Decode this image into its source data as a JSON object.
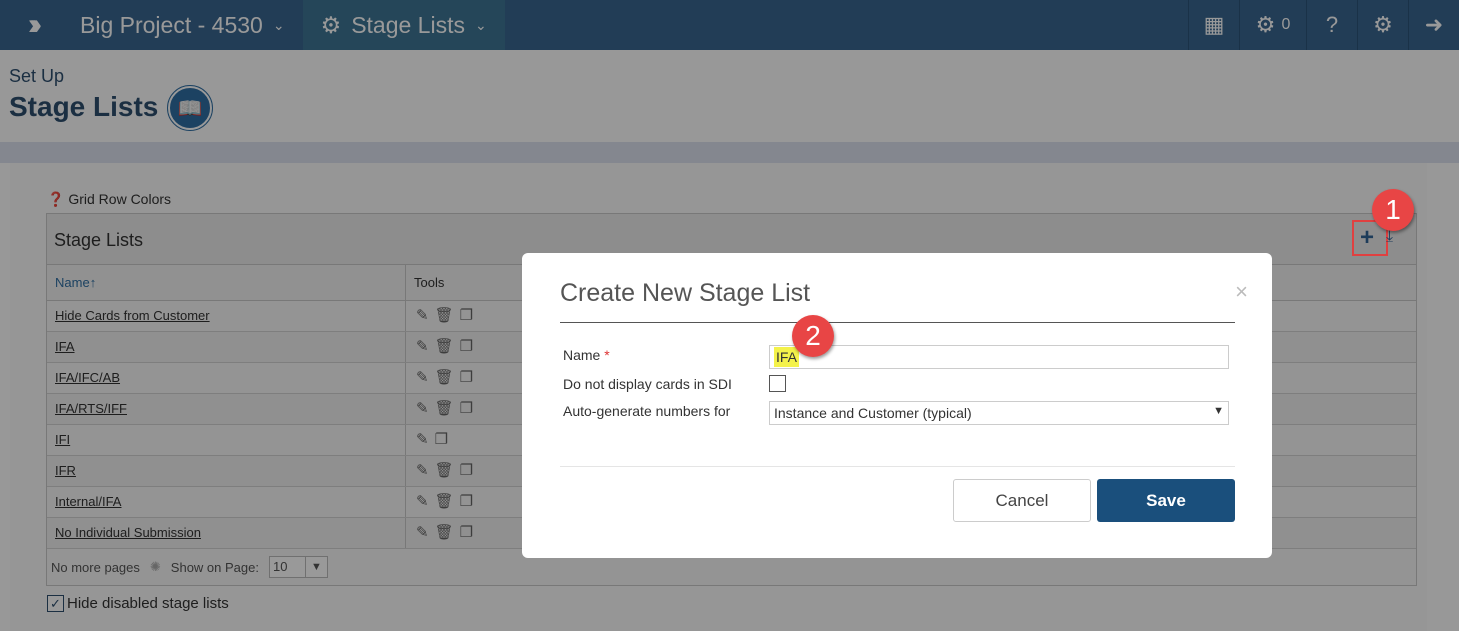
{
  "header": {
    "project": "Big Project - 4530",
    "section": "Stage Lists",
    "task_count": "0",
    "icons": [
      "menu-chevrons-icon",
      "schedule-icon",
      "gears-icon",
      "help-icon",
      "settings-icon",
      "logout-icon"
    ]
  },
  "page": {
    "supertitle": "Set Up",
    "title": "Stage Lists",
    "grid_row_colors": "Grid Row Colors"
  },
  "grid": {
    "title": "Stage Lists",
    "columns": [
      "Name",
      "Tools"
    ],
    "rows": [
      {
        "name": "Hide Cards from Customer",
        "delete": true
      },
      {
        "name": "IFA",
        "delete": true
      },
      {
        "name": "IFA/IFC/AB",
        "delete": true
      },
      {
        "name": "IFA/RTS/IFF",
        "delete": true
      },
      {
        "name": "IFI",
        "delete": false
      },
      {
        "name": "IFR",
        "delete": true
      },
      {
        "name": "Internal/IFA",
        "delete": true
      },
      {
        "name": "No Individual Submission",
        "delete": true
      }
    ],
    "pager": {
      "status": "No more pages",
      "show_label": "Show on Page:",
      "page_size": "10"
    },
    "hide_disabled": "Hide disabled stage lists"
  },
  "annotations": {
    "one": "1",
    "two": "2",
    "color": "#e84545"
  },
  "modal": {
    "title": "Create New Stage List",
    "close": "×",
    "name_label": "Name",
    "required": "*",
    "name_value": "IFA",
    "sdi_label": "Do not display cards in SDI",
    "sdi_checked": false,
    "auto_label": "Auto-generate numbers for",
    "auto_value": "Instance and Customer (typical)",
    "cancel": "Cancel",
    "save": "Save"
  }
}
